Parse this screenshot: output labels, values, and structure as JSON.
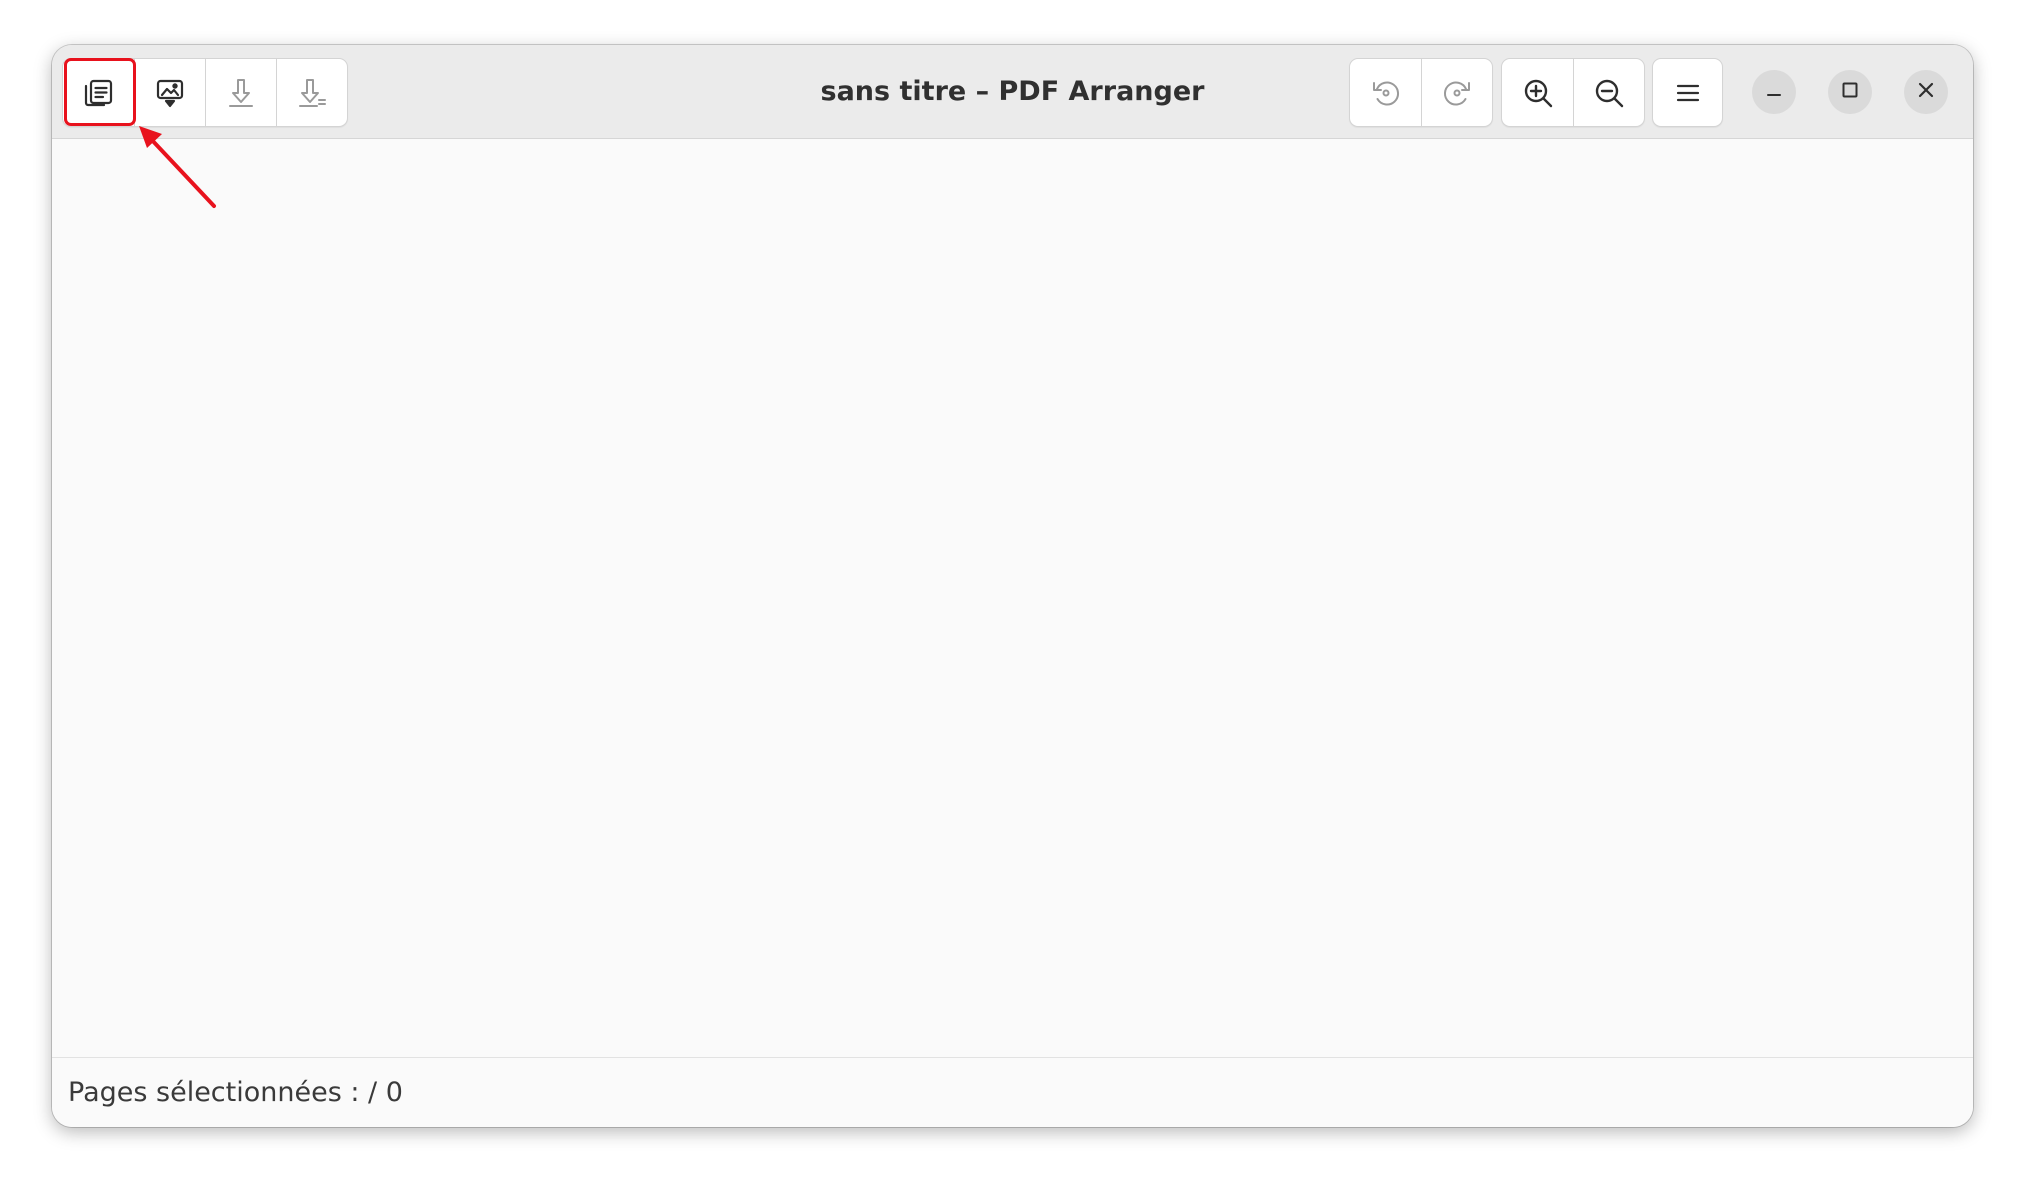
{
  "window": {
    "title": "sans titre – PDF Arranger"
  },
  "toolbar": {
    "left_buttons": [
      {
        "name": "open-file-button",
        "icon": "documents-icon"
      },
      {
        "name": "import-button",
        "icon": "import-image-icon"
      },
      {
        "name": "save-button",
        "icon": "download-icon"
      },
      {
        "name": "save-as-button",
        "icon": "download-edit-icon"
      }
    ],
    "right_buttons": [
      {
        "name": "rotate-left-button",
        "icon": "rotate-left-icon"
      },
      {
        "name": "rotate-right-button",
        "icon": "rotate-right-icon"
      },
      {
        "name": "zoom-in-button",
        "icon": "zoom-in-icon"
      },
      {
        "name": "zoom-out-button",
        "icon": "zoom-out-icon"
      },
      {
        "name": "main-menu-button",
        "icon": "hamburger-icon"
      }
    ],
    "window_controls": [
      {
        "name": "minimize-button",
        "icon": "minimize-icon"
      },
      {
        "name": "maximize-button",
        "icon": "maximize-icon"
      },
      {
        "name": "close-button",
        "icon": "close-icon"
      }
    ]
  },
  "statusbar": {
    "text": "Pages sélectionnées :  / 0"
  },
  "annotation": {
    "highlight_color": "#e8121d",
    "target": "open-file-button"
  }
}
